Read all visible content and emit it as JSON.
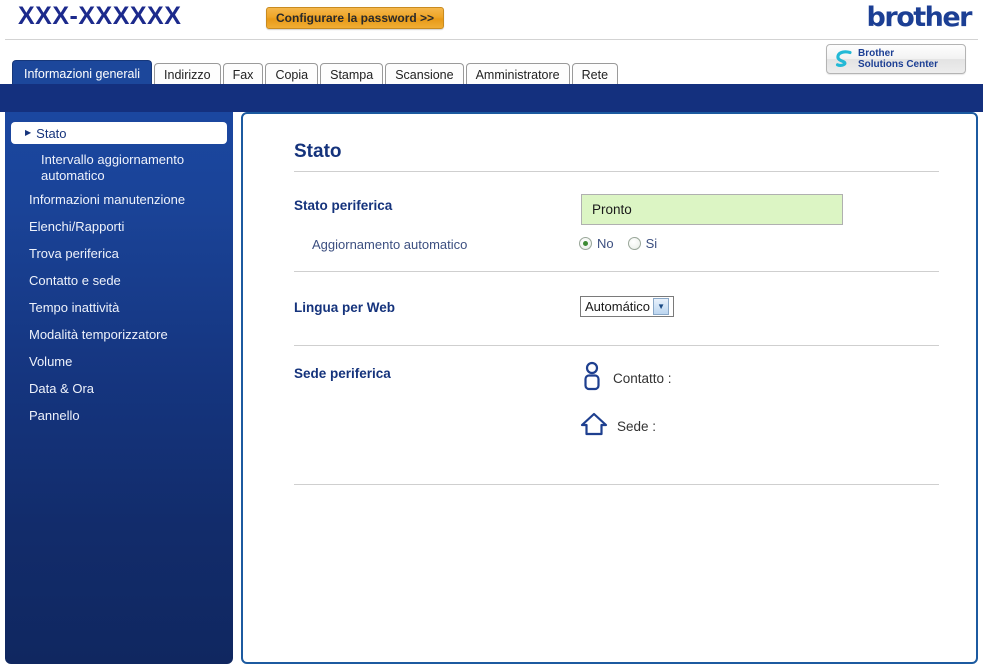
{
  "header": {
    "model_title": "XXX-XXXXXX",
    "password_button": "Configurare la password >>",
    "brand_logo": "brother",
    "solutions_center_line1": "Brother",
    "solutions_center_line2": "Solutions Center"
  },
  "tabs": [
    {
      "label": "Informazioni generali",
      "active": true
    },
    {
      "label": "Indirizzo",
      "active": false
    },
    {
      "label": "Fax",
      "active": false
    },
    {
      "label": "Copia",
      "active": false
    },
    {
      "label": "Stampa",
      "active": false
    },
    {
      "label": "Scansione",
      "active": false
    },
    {
      "label": "Amministratore",
      "active": false
    },
    {
      "label": "Rete",
      "active": false
    }
  ],
  "sidebar": {
    "items": [
      {
        "label": "Stato",
        "active": true,
        "sub": false
      },
      {
        "label": "Intervallo aggiornamento automatico",
        "active": false,
        "sub": true
      },
      {
        "label": "Informazioni manutenzione",
        "active": false,
        "sub": false
      },
      {
        "label": "Elenchi/Rapporti",
        "active": false,
        "sub": false
      },
      {
        "label": "Trova periferica",
        "active": false,
        "sub": false
      },
      {
        "label": "Contatto e sede",
        "active": false,
        "sub": false
      },
      {
        "label": "Tempo inattività",
        "active": false,
        "sub": false
      },
      {
        "label": "Modalità temporizzatore",
        "active": false,
        "sub": false
      },
      {
        "label": "Volume",
        "active": false,
        "sub": false
      },
      {
        "label": "Data & Ora",
        "active": false,
        "sub": false
      },
      {
        "label": "Pannello",
        "active": false,
        "sub": false
      }
    ]
  },
  "main": {
    "page_title": "Stato",
    "device_status_label": "Stato periferica",
    "device_status_value": "Pronto",
    "auto_refresh_label": "Aggiornamento automatico",
    "auto_refresh_no": "No",
    "auto_refresh_yes": "Si",
    "auto_refresh_selected": "No",
    "web_language_label": "Lingua per Web",
    "web_language_value": "Automático",
    "device_location_label": "Sede periferica",
    "contact_label": "Contatto :",
    "location_label": "Sede :"
  },
  "colors": {
    "brand_blue": "#14307e",
    "accent_blue": "#1c479b",
    "panel_border": "#1c5aa0",
    "status_green_bg": "#dcf5c4",
    "button_orange": "#efa628"
  }
}
